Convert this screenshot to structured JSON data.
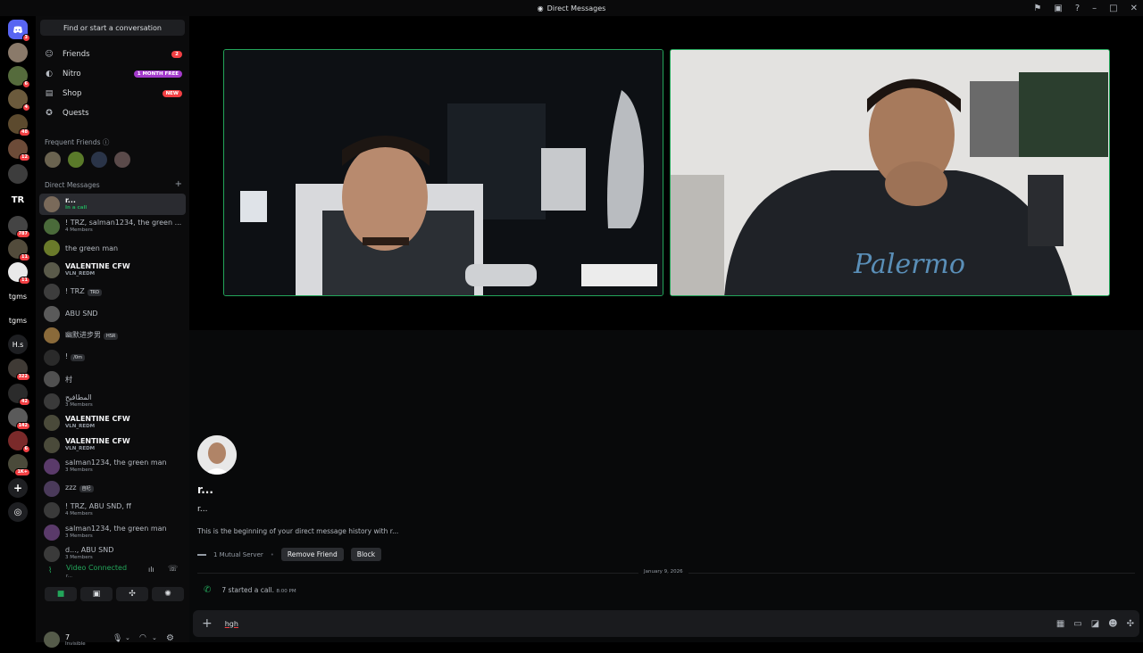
{
  "window": {
    "title": "Direct Messages"
  },
  "sidebar": {
    "find_label": "Find or start a conversation",
    "nav": [
      {
        "label": "Friends",
        "badge": "2"
      },
      {
        "label": "Nitro",
        "badge": "1 MONTH FREE"
      },
      {
        "label": "Shop",
        "badge": "NEW"
      },
      {
        "label": "Quests",
        "badge": ""
      }
    ],
    "frequent_friends_label": "Frequent Friends",
    "direct_messages_label": "Direct Messages",
    "dms": [
      {
        "name": "r...",
        "sub": "In a call",
        "bold": true,
        "selected": true
      },
      {
        "name": "! TRZ, salman1234, the green ...",
        "sub": "4 Members"
      },
      {
        "name": "the green man",
        "sub": ""
      },
      {
        "name": "VALENTINE CFW",
        "sub": "VLN_REDM",
        "bold": true
      },
      {
        "name": "! TRZ",
        "sub": "",
        "tag": "TRD"
      },
      {
        "name": "ABU SND",
        "sub": ""
      },
      {
        "name": "幽默进步男",
        "sub": "",
        "tag": "HSR"
      },
      {
        "name": "!",
        "sub": "",
        "tag": "/0m"
      },
      {
        "name": "村",
        "sub": ""
      },
      {
        "name": "المطافيح",
        "sub": "3 Members"
      },
      {
        "name": "VALENTINE CFW",
        "sub": "VLN_REDM",
        "bold": true
      },
      {
        "name": "VALENTINE CFW",
        "sub": "VLN_REDM",
        "bold": true
      },
      {
        "name": "salman1234, the green man",
        "sub": "3 Members"
      },
      {
        "name": "zzz",
        "sub": "",
        "tag": "自杞"
      },
      {
        "name": "! TRZ, ABU SND, ff",
        "sub": "4 Members"
      },
      {
        "name": "salman1234, the green man",
        "sub": "3 Members"
      },
      {
        "name": "d..., ABU SND",
        "sub": "3 Members"
      }
    ],
    "voice": {
      "status": "Video Connected",
      "channel": "r..."
    },
    "user": {
      "name": "7",
      "status": "Invisible"
    }
  },
  "servers": [
    {
      "label": "",
      "badge": "3"
    },
    {
      "label": "",
      "badge": ""
    },
    {
      "label": "",
      "badge": "6"
    },
    {
      "label": "",
      "badge": "4"
    },
    {
      "label": "",
      "badge": "48"
    },
    {
      "label": "",
      "badge": "12"
    },
    {
      "label": "",
      "badge": ""
    },
    {
      "label": "TR",
      "badge": ""
    },
    {
      "label": "",
      "badge": "787"
    },
    {
      "label": "",
      "badge": "11"
    },
    {
      "label": "",
      "badge": "11"
    },
    {
      "label": "tgms",
      "badge": ""
    },
    {
      "label": "tgms",
      "badge": ""
    },
    {
      "label": "H.s",
      "badge": ""
    },
    {
      "label": "",
      "badge": "322"
    },
    {
      "label": "",
      "badge": "42"
    },
    {
      "label": "",
      "badge": "142"
    },
    {
      "label": "",
      "badge": "6"
    },
    {
      "label": "",
      "badge": "1K+"
    }
  ],
  "main": {
    "dm_title": "r...",
    "dm_username": "r...",
    "intro": "This is the beginning of your direct message history with r...",
    "mutual": "1 Mutual Server",
    "remove_friend": "Remove Friend",
    "block": "Block",
    "date": "January 9, 2026",
    "call_msg": "7 started a call.",
    "call_time": "8:00 PM",
    "composer_text": "hgh"
  }
}
